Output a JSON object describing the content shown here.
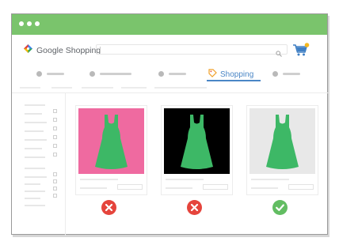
{
  "window": {
    "titlebar_color": "#7ac46c",
    "titlebar_icons": [
      "window-dot-icon",
      "window-dot-icon",
      "window-dot-icon"
    ]
  },
  "header": {
    "logo_text": "Google Shopping",
    "logo_icon": "google-shopping-tag-icon",
    "search_icon": "search-icon",
    "cart_icon": "shopping-cart-icon",
    "cart_badge_color": "#f5b81f"
  },
  "tabs": {
    "active_label": "Shopping",
    "active_icon": "shopping-tag-icon",
    "active_color": "#4a86c6"
  },
  "products": [
    {
      "background": "#ef6aa0",
      "dress_color": "#3db866",
      "verdict": "rejected",
      "verdict_icon": "x-circle-icon",
      "verdict_color": "#e5443c"
    },
    {
      "background": "#000000",
      "dress_color": "#3db866",
      "verdict": "rejected",
      "verdict_icon": "x-circle-icon",
      "verdict_color": "#e5443c"
    },
    {
      "background": "#e8e8e8",
      "dress_color": "#3db866",
      "verdict": "approved",
      "verdict_icon": "check-circle-icon",
      "verdict_color": "#62bd62"
    }
  ]
}
